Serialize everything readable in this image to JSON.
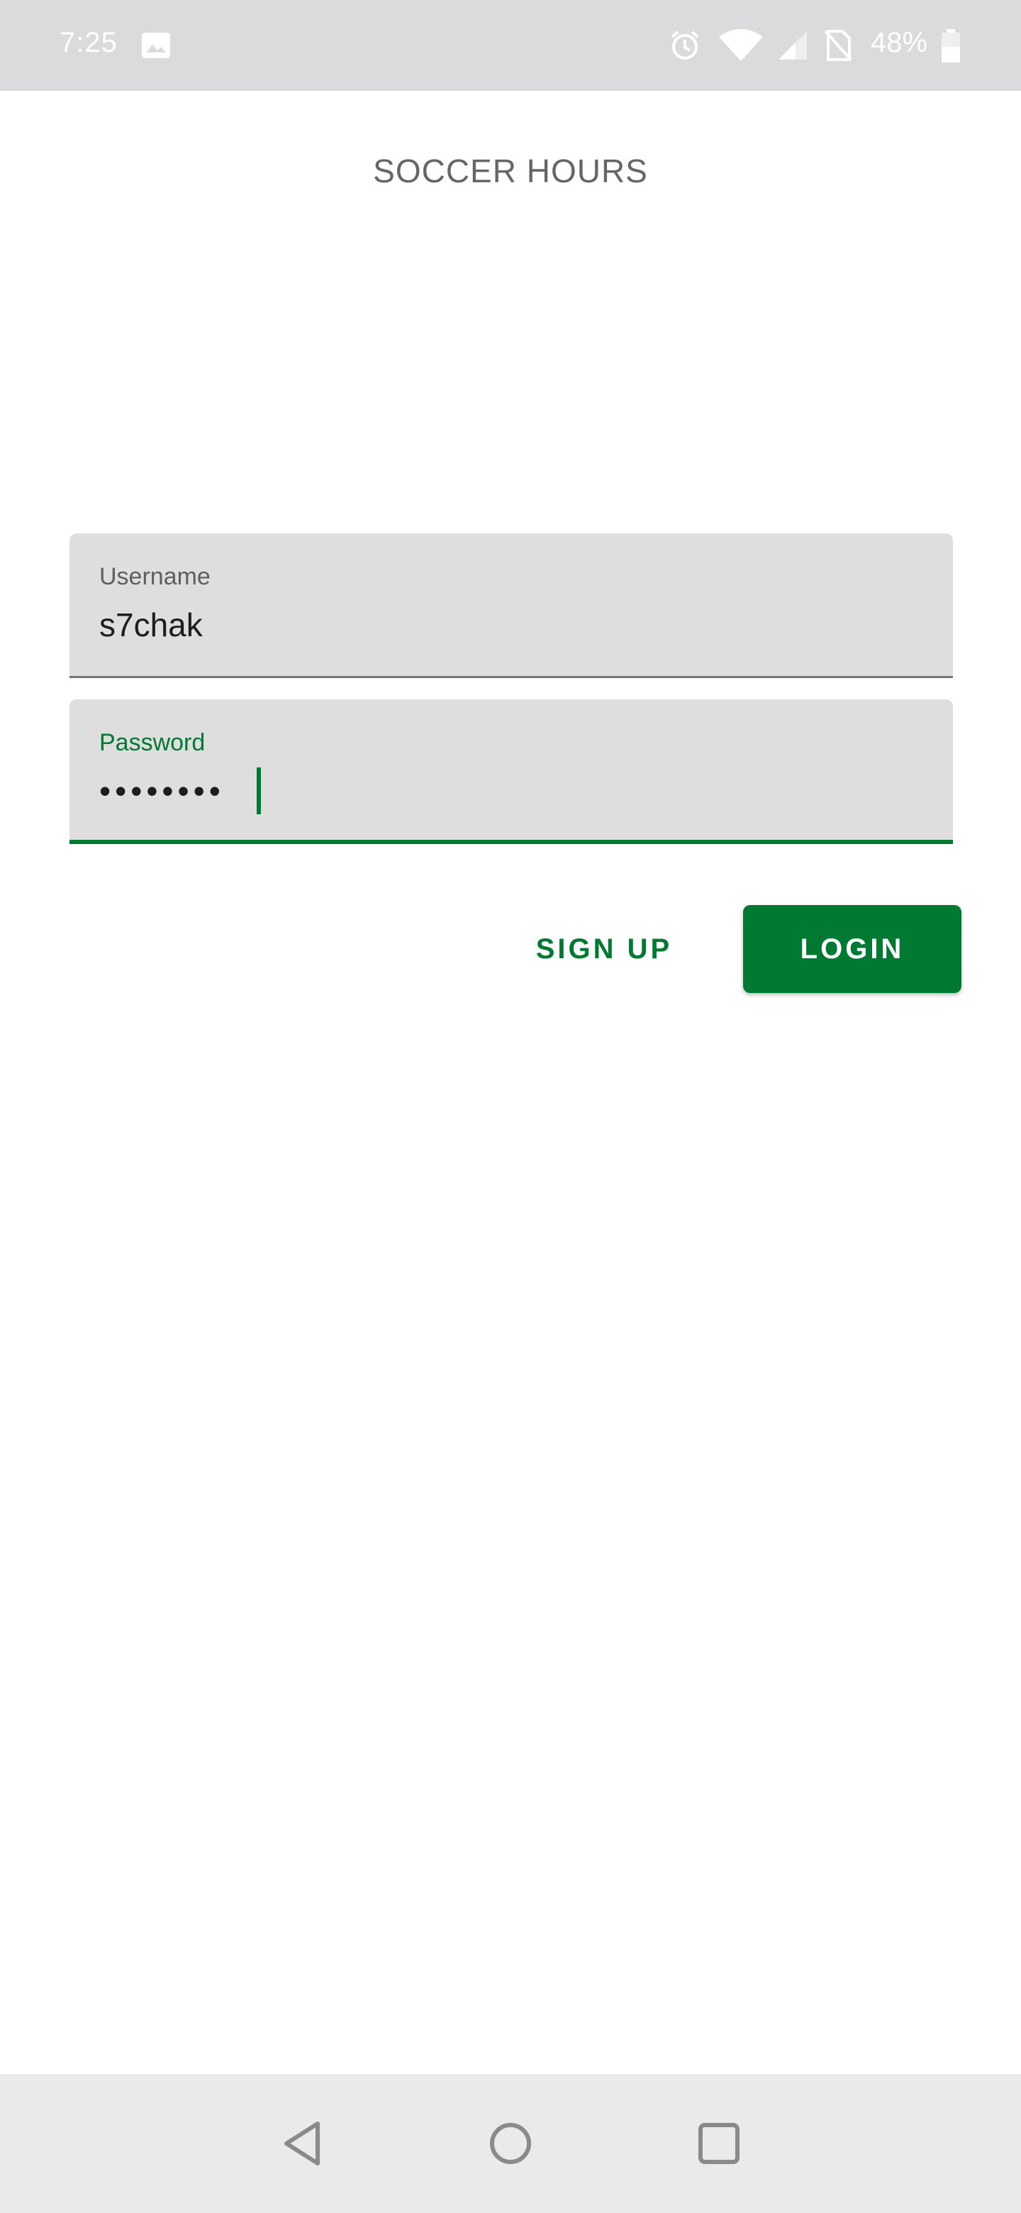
{
  "status_bar": {
    "time": "7:25",
    "battery_percent": "48%",
    "icons": [
      "image-icon",
      "alarm-icon",
      "wifi-icon",
      "signal-icon",
      "no-sim-icon",
      "battery-icon"
    ]
  },
  "app": {
    "title": "SOCCER HOURS"
  },
  "form": {
    "username": {
      "label": "Username",
      "value": "s7chak"
    },
    "password": {
      "label": "Password",
      "masked_value": "••••••••"
    }
  },
  "buttons": {
    "signup_label": "SIGN UP",
    "login_label": "LOGIN"
  },
  "nav_bar": {
    "icons": [
      "back-icon",
      "home-icon",
      "recents-icon"
    ]
  },
  "colors": {
    "accent": "#007a33",
    "field_background": "#dedede",
    "status_bar_background": "#dadbdd",
    "nav_bar_background": "#eaeaea"
  }
}
